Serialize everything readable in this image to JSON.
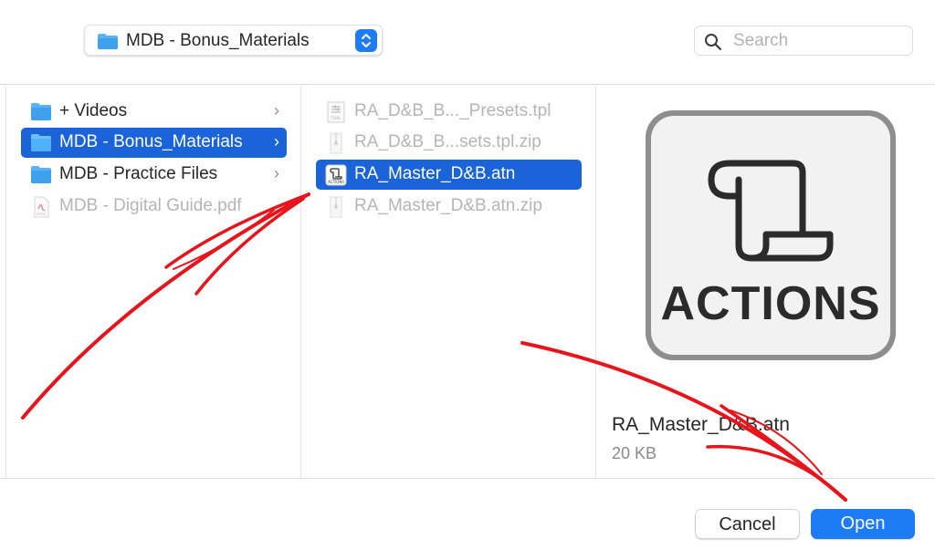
{
  "toolbar": {
    "location": "MDB - Bonus_Materials",
    "search_placeholder": "Search"
  },
  "columns": {
    "first": [
      {
        "name": "+ Videos",
        "kind": "folder",
        "chevron": "›",
        "state": "normal"
      },
      {
        "name": "MDB - Bonus_Materials",
        "kind": "folder",
        "chevron": "›",
        "state": "selected"
      },
      {
        "name": "MDB - Practice Files",
        "kind": "folder",
        "chevron": "›",
        "state": "normal"
      },
      {
        "name": "MDB - Digital Guide.pdf",
        "kind": "pdf",
        "state": "dim"
      }
    ],
    "second": [
      {
        "name": "RA_D&B_B..._Presets.tpl",
        "kind": "tool-file",
        "state": "dim"
      },
      {
        "name": "RA_D&B_B...sets.tpl.zip",
        "kind": "zip-file",
        "state": "dim"
      },
      {
        "name": "RA_Master_D&B.atn",
        "kind": "actions-file",
        "state": "selected"
      },
      {
        "name": "RA_Master_D&B.atn.zip",
        "kind": "zip-file",
        "state": "dim"
      }
    ]
  },
  "preview": {
    "icon_label": "ACTIONS",
    "file_name": "RA_Master_D&B.atn",
    "file_size": "20 KB"
  },
  "footer": {
    "cancel_label": "Cancel",
    "open_label": "Open"
  },
  "colors": {
    "accent": "#1d7bf6",
    "selection": "#1a63d8",
    "folder": "#5ab2f5",
    "annotation": "#e8141c"
  }
}
